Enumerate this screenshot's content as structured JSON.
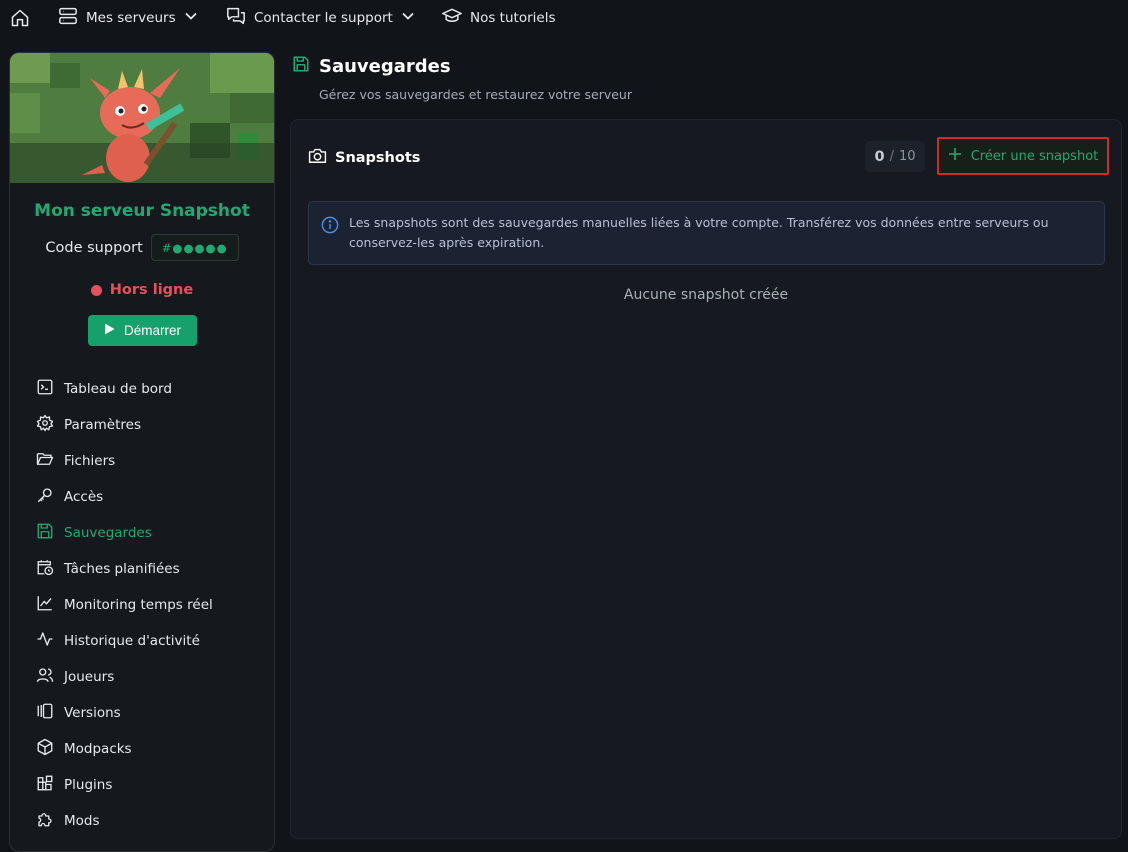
{
  "topbar": {
    "servers_label": "Mes serveurs",
    "support_label": "Contacter le support",
    "tutorials_label": "Nos tutoriels"
  },
  "sidebar": {
    "server_name": "Mon serveur Snapshot",
    "support_code_label": "Code support",
    "support_code_value": "#●●●●●",
    "status": "Hors ligne",
    "start_label": "Démarrer",
    "items": [
      {
        "label": "Tableau de bord",
        "icon": "terminal-icon"
      },
      {
        "label": "Paramètres",
        "icon": "gear-icon"
      },
      {
        "label": "Fichiers",
        "icon": "folder-icon"
      },
      {
        "label": "Accès",
        "icon": "key-icon"
      },
      {
        "label": "Sauvegardes",
        "icon": "save-icon",
        "active": true
      },
      {
        "label": "Tâches planifiées",
        "icon": "calendar-clock-icon"
      },
      {
        "label": "Monitoring temps réel",
        "icon": "line-chart-icon"
      },
      {
        "label": "Historique d'activité",
        "icon": "activity-icon"
      },
      {
        "label": "Joueurs",
        "icon": "users-icon"
      },
      {
        "label": "Versions",
        "icon": "versions-icon"
      },
      {
        "label": "Modpacks",
        "icon": "cube-icon"
      },
      {
        "label": "Plugins",
        "icon": "blocks-icon"
      },
      {
        "label": "Mods",
        "icon": "puzzle-icon"
      }
    ]
  },
  "main": {
    "title": "Sauvegardes",
    "subtitle": "Gérez vos sauvegardes et restaurez votre serveur",
    "panel": {
      "title": "Snapshots",
      "count_current": "0",
      "count_sep": "/",
      "count_max": "10",
      "create_label": "Créer une snapshot",
      "info_text": "Les snapshots sont des sauvegardes manuelles liées à votre compte. Transférez vos données entre serveurs ou conservez-les après expiration.",
      "empty_text": "Aucune snapshot créée"
    }
  },
  "colors": {
    "accent": "#22a870",
    "danger": "#e5505a",
    "highlight_border": "#d12a2a"
  }
}
